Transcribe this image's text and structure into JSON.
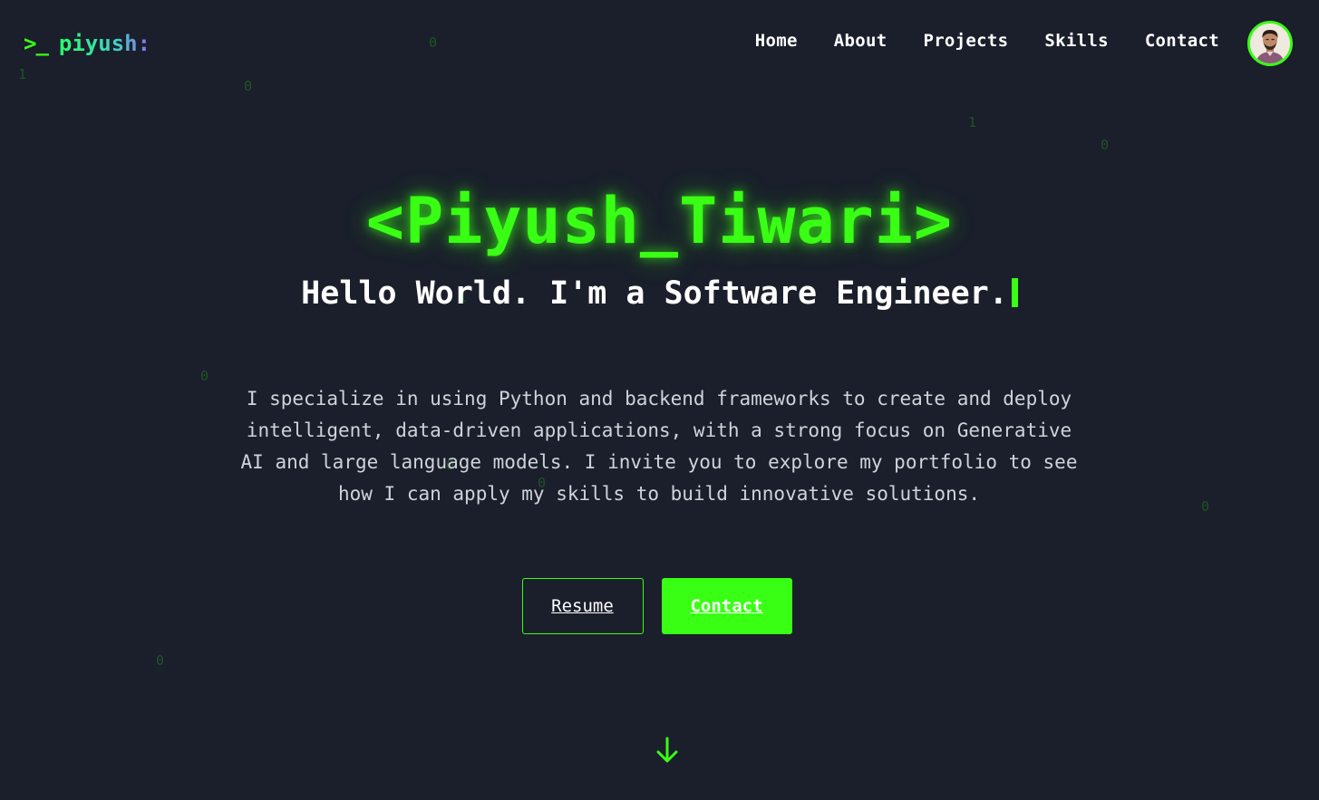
{
  "nav": {
    "brand_prompt": ">_",
    "brand_name": "piyush:",
    "links": [
      "Home",
      "About",
      "Projects",
      "Skills",
      "Contact"
    ]
  },
  "hero": {
    "title": "<Piyush_Tiwari>",
    "subtitle": "Hello World. I'm a Software Engineer.",
    "description": "I specialize in using Python and backend frameworks to create and deploy intelligent, data-driven applications, with a strong focus on Generative AI and large language models. I invite you to explore my portfolio to see how I can apply my skills to build innovative solutions.",
    "buttons": {
      "resume": "Resume",
      "contact": "Contact"
    }
  },
  "background_digits": [
    "1",
    "0",
    "0",
    "1",
    "0",
    "0",
    "1",
    "1",
    "0",
    "0",
    "0",
    "0"
  ],
  "colors": {
    "background": "#1a1f2b",
    "accent": "#39ff14",
    "text": "#ffffff",
    "muted_text": "#cfd3da"
  },
  "icons": {
    "scroll": "arrow-down-icon",
    "avatar": "profile-photo"
  }
}
